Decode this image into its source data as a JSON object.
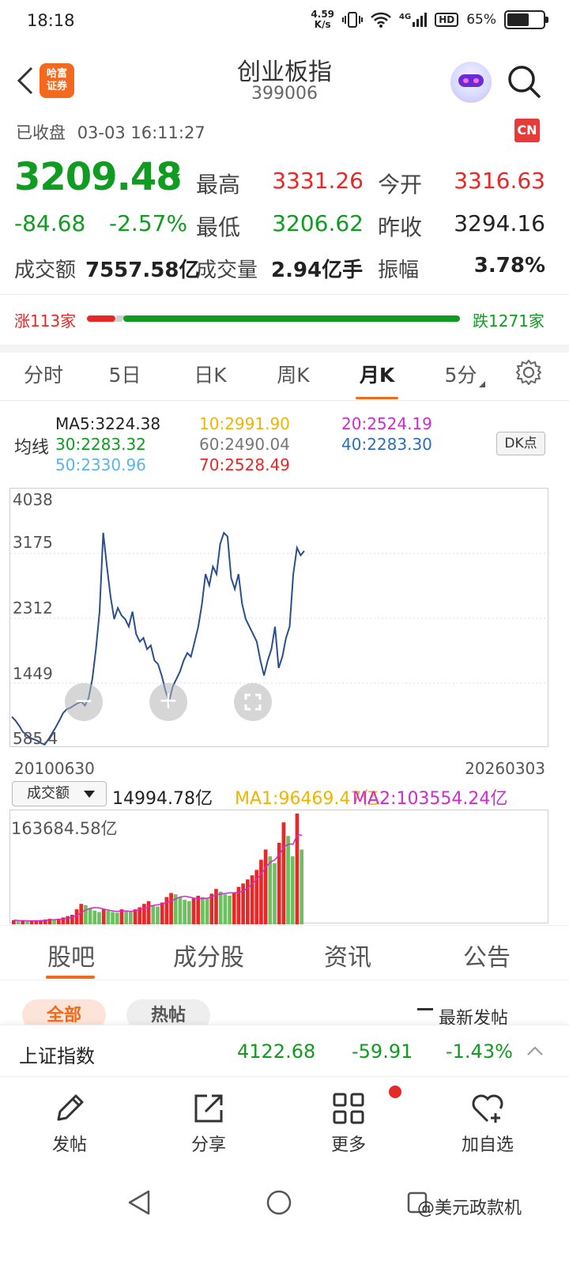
{
  "status": {
    "time": "18:18",
    "net_speed_top": "4.59",
    "net_speed_bottom": "K/s",
    "network": "4G",
    "hd": "HD",
    "battery": "65%",
    "battery_level": 0.65
  },
  "header": {
    "logo_line1": "哈富",
    "logo_line2": "证券",
    "title": "创业板指",
    "code": "399006"
  },
  "quote": {
    "status_text": "已收盘",
    "datetime": "03-03 16:11:27",
    "market_badge": "CN",
    "price": "3209.48",
    "change": "-84.68",
    "change_pct": "-2.57%",
    "high_label": "最高",
    "high": "3331.26",
    "open_label": "今开",
    "open": "3316.63",
    "low_label": "最低",
    "low": "3206.62",
    "prev_close_label": "昨收",
    "prev_close": "3294.16",
    "turnover_label": "成交额",
    "turnover": "7557.58亿",
    "volume_label": "成交量",
    "volume": "2.94亿手",
    "amplitude_label": "振幅",
    "amplitude": "3.78%"
  },
  "breadth": {
    "up": "涨113家",
    "down": "跌1271家",
    "up_count": 113,
    "down_count": 1271
  },
  "period_tabs": [
    "分时",
    "5日",
    "日K",
    "周K",
    "月K",
    "5分"
  ],
  "active_period": "月K",
  "ma": {
    "label": "均线",
    "ma5": "MA5:3224.38",
    "ma10": "10:2991.90",
    "ma20": "20:2524.19",
    "ma30": "30:2283.32",
    "ma60": "60:2490.04",
    "ma40": "40:2283.30",
    "ma50": "50:2330.96",
    "ma70": "70:2528.49",
    "dk_button": "DK点"
  },
  "colors": {
    "red": "#e62828",
    "green": "#109c20",
    "accent": "#f06a1c",
    "kline": "#2b4f8c",
    "ma10": "#f0b400",
    "ma20": "#d02bd0",
    "ma30": "#109c20",
    "ma40": "#2c6fb5",
    "ma50": "#5ab4ee",
    "ma60": "#777777",
    "ma70": "#e62828"
  },
  "chart": {
    "y_ticks": [
      "4038",
      "3175",
      "2312",
      "1449",
      "585.4"
    ],
    "start_date": "20100630",
    "end_date": "20260303"
  },
  "chart_data": {
    "type": "line",
    "title": "",
    "x_range": [
      "20100630",
      "20260303"
    ],
    "ylim": [
      585.4,
      4038
    ],
    "series": [
      {
        "name": "",
        "values": [
          1000,
          950,
          880,
          800,
          760,
          720,
          700,
          680,
          650,
          630,
          700,
          780,
          860,
          950,
          1050,
          1100,
          1120,
          1150,
          1180,
          1200,
          1150,
          1250,
          1500,
          1900,
          2400,
          3450,
          3000,
          2600,
          2300,
          2450,
          2350,
          2300,
          2200,
          2400,
          2100,
          2000,
          2050,
          1900,
          1950,
          1750,
          1700,
          1550,
          1350,
          1200,
          1400,
          1500,
          1600,
          1750,
          1850,
          1800,
          2000,
          2200,
          2500,
          2900,
          2750,
          3000,
          2900,
          3300,
          3450,
          3400,
          2850,
          2700,
          2900,
          2500,
          2300,
          2200,
          2100,
          2000,
          1750,
          1550,
          1750,
          1900,
          2200,
          1650,
          1800,
          2050,
          2200,
          2900,
          3250,
          3150,
          3209
        ]
      }
    ]
  },
  "volume": {
    "selector": "成交额",
    "value": "14994.78亿",
    "ma1": "MA1:96469.47亿",
    "ma2": "MA2:103554.24亿",
    "max_label": "163684.58亿"
  },
  "volume_data": {
    "values": [
      6,
      5,
      5,
      4,
      5,
      6,
      6,
      7,
      8,
      7,
      8,
      10,
      12,
      14,
      22,
      30,
      28,
      24,
      20,
      18,
      22,
      20,
      18,
      17,
      22,
      20,
      18,
      22,
      25,
      30,
      34,
      28,
      26,
      32,
      40,
      46,
      44,
      40,
      36,
      34,
      38,
      42,
      40,
      38,
      45,
      52,
      48,
      44,
      42,
      46,
      55,
      60,
      66,
      72,
      80,
      95,
      110,
      100,
      90,
      120,
      150,
      130,
      100,
      163,
      110
    ]
  },
  "content_tabs": [
    "股吧",
    "成分股",
    "资讯",
    "公告"
  ],
  "active_content_tab": "股吧",
  "sub_filters": {
    "all": "全部",
    "hot": "热帖",
    "sort": "最新发帖"
  },
  "ticker": {
    "name": "上证指数",
    "price": "4122.68",
    "change": "-59.91",
    "change_pct": "-1.43%"
  },
  "actions": {
    "post": "发帖",
    "share": "分享",
    "more": "更多",
    "add_watch": "加自选"
  },
  "watermark": "@美元政款机"
}
